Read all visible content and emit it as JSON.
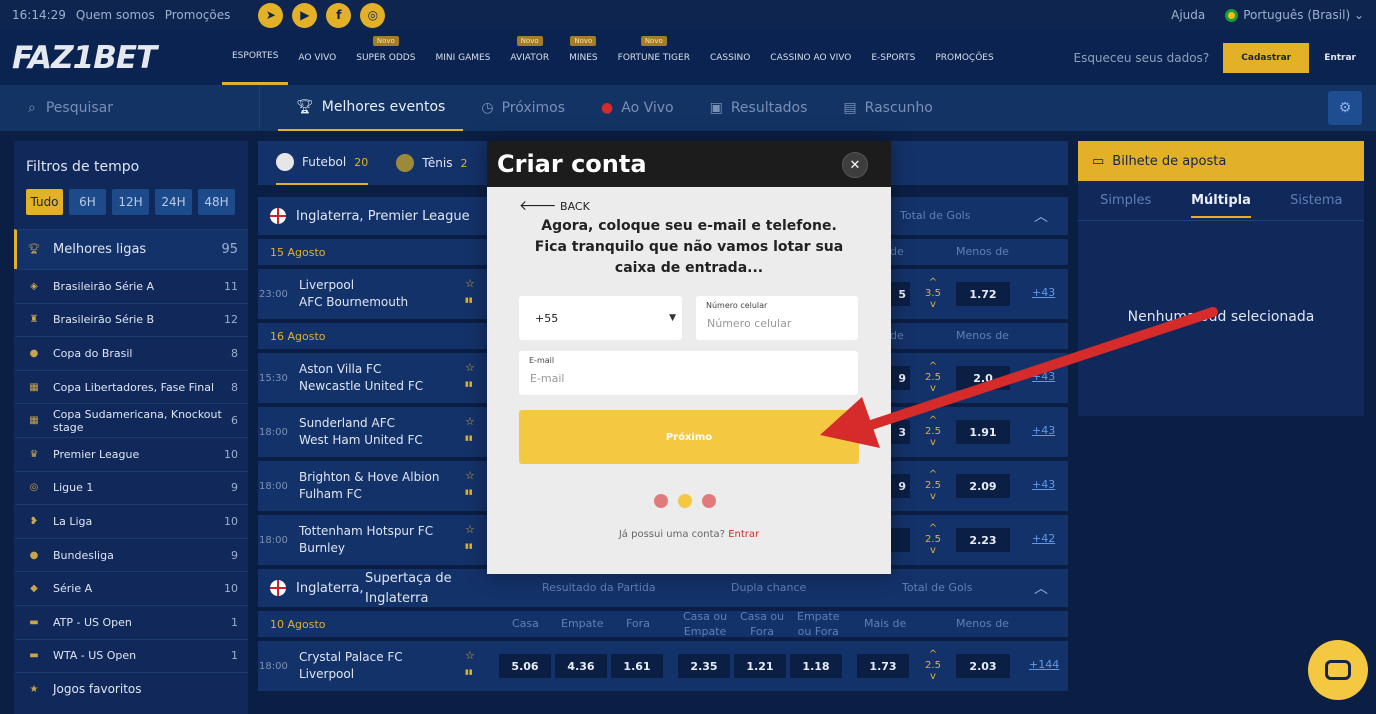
{
  "topbar": {
    "time": "16:14:29",
    "links": [
      "Quem somos",
      "Promoções"
    ],
    "help": "Ajuda",
    "language": "Português (Brasil)"
  },
  "nav": {
    "logo": "FAZ1BET",
    "items": [
      {
        "label": "ESPORTES",
        "badge": ""
      },
      {
        "label": "AO VIVO",
        "badge": ""
      },
      {
        "label": "SUPER ODDS",
        "badge": "Novo"
      },
      {
        "label": "MINI GAMES",
        "badge": ""
      },
      {
        "label": "AVIATOR",
        "badge": "Novo"
      },
      {
        "label": "MINES",
        "badge": "Novo"
      },
      {
        "label": "FORTUNE TIGER",
        "badge": "Novo"
      },
      {
        "label": "CASSINO",
        "badge": ""
      },
      {
        "label": "CASSINO AO VIVO",
        "badge": ""
      },
      {
        "label": "E-SPORTS",
        "badge": ""
      },
      {
        "label": "PROMOÇÕES",
        "badge": ""
      }
    ],
    "forgot": "Esqueceu seus dados?",
    "register": "Cadastrar",
    "login": "Entrar"
  },
  "subnav": {
    "search": "Pesquisar",
    "tabs": [
      "Melhores eventos",
      "Próximos",
      "Ao Vivo",
      "Resultados",
      "Rascunho"
    ]
  },
  "filters": {
    "title": "Filtros de tempo",
    "times": [
      "Tudo",
      "6H",
      "12H",
      "24H",
      "48H"
    ],
    "best": {
      "label": "Melhores ligas",
      "count": "95"
    },
    "leagues": [
      {
        "name": "Brasileirão Série A",
        "count": "11"
      },
      {
        "name": "Brasileirão Série B",
        "count": "12"
      },
      {
        "name": "Copa do Brasil",
        "count": "8"
      },
      {
        "name": "Copa Libertadores, Fase Final",
        "count": "8"
      },
      {
        "name": "Copa Sudamericana, Knockout stage",
        "count": "6"
      },
      {
        "name": "Premier League",
        "count": "10"
      },
      {
        "name": "Ligue 1",
        "count": "9"
      },
      {
        "name": "La Liga",
        "count": "10"
      },
      {
        "name": "Bundesliga",
        "count": "9"
      },
      {
        "name": "Série A",
        "count": "10"
      },
      {
        "name": "ATP - US Open",
        "count": "1"
      },
      {
        "name": "WTA - US Open",
        "count": "1"
      }
    ],
    "favorites": "Jogos favoritos"
  },
  "sports": [
    {
      "name": "Futebol",
      "count": "20"
    },
    {
      "name": "Tênis",
      "count": "2"
    }
  ],
  "comp1": {
    "name": "Inglaterra, Premier League",
    "total": "Total de Gols"
  },
  "date1": {
    "label": "15 Agosto",
    "mais": "de",
    "menos": "Menos de"
  },
  "date2": {
    "label": "16 Agosto",
    "mais": "de",
    "menos": "Menos de"
  },
  "matches1": [
    {
      "time": "23:00",
      "home": "Liverpool",
      "away": "AFC Bournemouth",
      "o1": "5",
      "line": "3.5",
      "o2": "1.72",
      "more": "+43"
    }
  ],
  "matches2": [
    {
      "time": "15:30",
      "home": "Aston Villa FC",
      "away": "Newcastle United FC",
      "o1": "9",
      "line": "2.5",
      "o2": "2.0",
      "more": "+43"
    },
    {
      "time": "18:00",
      "home": "Sunderland AFC",
      "away": "West Ham United FC",
      "o1": "3",
      "line": "2.5",
      "o2": "1.91",
      "more": "+43"
    },
    {
      "time": "18:00",
      "home": "Brighton & Hove Albion",
      "away": "Fulham FC",
      "o1": "9",
      "line": "2.5",
      "o2": "2.09",
      "more": "+43"
    },
    {
      "time": "18:00",
      "home": "Tottenham Hotspur FC",
      "away": "Burnley",
      "o1": "",
      "line": "2.5",
      "o2": "2.23",
      "more": "+42"
    }
  ],
  "comp2": {
    "name_a": "Inglaterra,",
    "name_b": "Supertaça de",
    "name_c": "Inglaterra",
    "result": "Resultado da Partida",
    "double": "Dupla chance",
    "total": "Total de Gols"
  },
  "date3": {
    "label": "10 Agosto",
    "casa": "Casa",
    "empate": "Empate",
    "fora": "Fora",
    "c_e_a": "Casa ou",
    "c_e_b": "Empate",
    "c_f_a": "Casa ou",
    "c_f_b": "Fora",
    "e_f_a": "Empate",
    "e_f_b": "ou Fora",
    "mais": "Mais de",
    "menos": "Menos de"
  },
  "match3": {
    "time": "18:00",
    "home": "Crystal Palace FC",
    "away": "Liverpool",
    "odds": [
      "5.06",
      "4.36",
      "1.61",
      "2.35",
      "1.21",
      "1.18",
      "1.73"
    ],
    "line": "2.5",
    "o2": "2.03",
    "more": "+144"
  },
  "betslip": {
    "title": "Bilhete de aposta",
    "tabs": [
      "Simples",
      "Múltipla",
      "Sistema"
    ],
    "empty": "Nenhuma odd selecionada"
  },
  "modal": {
    "title": "Criar conta",
    "back": "BACK",
    "message": "Agora, coloque seu e-mail e telefone. Fica tranquilo que não vamos lotar sua caixa de entrada...",
    "country_code": "+55",
    "phone_label": "Número celular",
    "phone_placeholder": "Número celular",
    "email_label": "E-mail",
    "email_placeholder": "E-mail",
    "next": "Próximo",
    "have_account": "Já possui uma conta?",
    "login": "Entrar"
  },
  "colors": {
    "accent": "#e3b128",
    "button": "#f5c842",
    "arrow": "#d62b2b"
  }
}
